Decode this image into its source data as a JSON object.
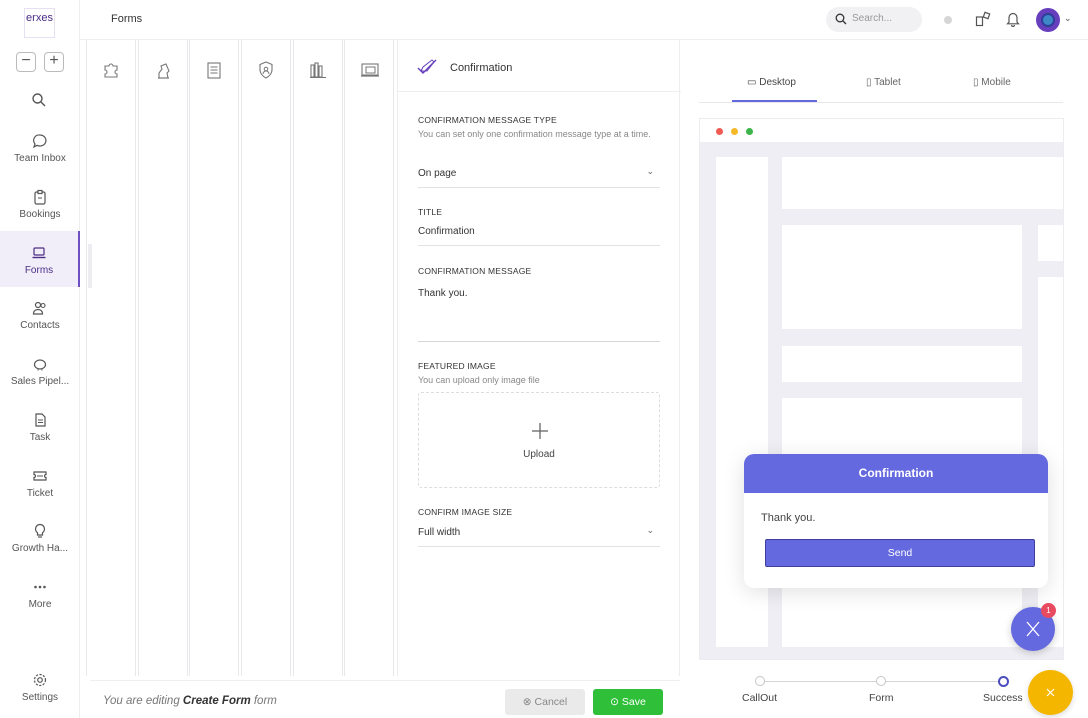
{
  "app": {
    "logo": "erxes",
    "page_title": "Forms"
  },
  "nav": {
    "zoom_out": "−",
    "zoom_in": "+",
    "items": [
      {
        "label": "Team Inbox",
        "icon": "chat-icon"
      },
      {
        "label": "Bookings",
        "icon": "clipboard-icon"
      },
      {
        "label": "Forms",
        "icon": "laptop-icon",
        "active": true
      },
      {
        "label": "Contacts",
        "icon": "people-icon"
      },
      {
        "label": "Sales Pipel...",
        "icon": "piggy-bank-icon"
      },
      {
        "label": "Task",
        "icon": "document-icon"
      },
      {
        "label": "Ticket",
        "icon": "ticket-icon"
      },
      {
        "label": "Growth Ha...",
        "icon": "lightbulb-icon"
      },
      {
        "label": "More",
        "icon": "more-icon"
      }
    ],
    "settings": "Settings"
  },
  "header": {
    "search_placeholder": "Search..."
  },
  "panel": {
    "heading": "Confirmation",
    "type_label": "CONFIRMATION MESSAGE TYPE",
    "type_hint": "You can set only one confirmation message type at a time.",
    "type_value": "On page",
    "title_label": "TITLE",
    "title_value": "Confirmation",
    "message_label": "CONFIRMATION MESSAGE",
    "message_value": "Thank you.",
    "image_label": "FEATURED IMAGE",
    "image_hint": "You can upload only image file",
    "upload_label": "Upload",
    "size_label": "CONFIRM IMAGE SIZE",
    "size_value": "Full width"
  },
  "footer": {
    "editing_prefix": "You are editing ",
    "form_name": "Create Form",
    "editing_suffix": " form",
    "cancel": "Cancel",
    "save": "Save"
  },
  "preview": {
    "tabs": [
      "Desktop",
      "Tablet",
      "Mobile"
    ],
    "active_tab": "Desktop",
    "popup_title": "Confirmation",
    "popup_message": "Thank you.",
    "popup_button": "Send",
    "badge_count": "1",
    "steps": [
      "CallOut",
      "Form",
      "Success"
    ],
    "active_step": "Success"
  },
  "colors": {
    "accent": "#6569df",
    "brand": "#673fbd",
    "save": "#2fbf39",
    "notify": "#f5b600"
  }
}
